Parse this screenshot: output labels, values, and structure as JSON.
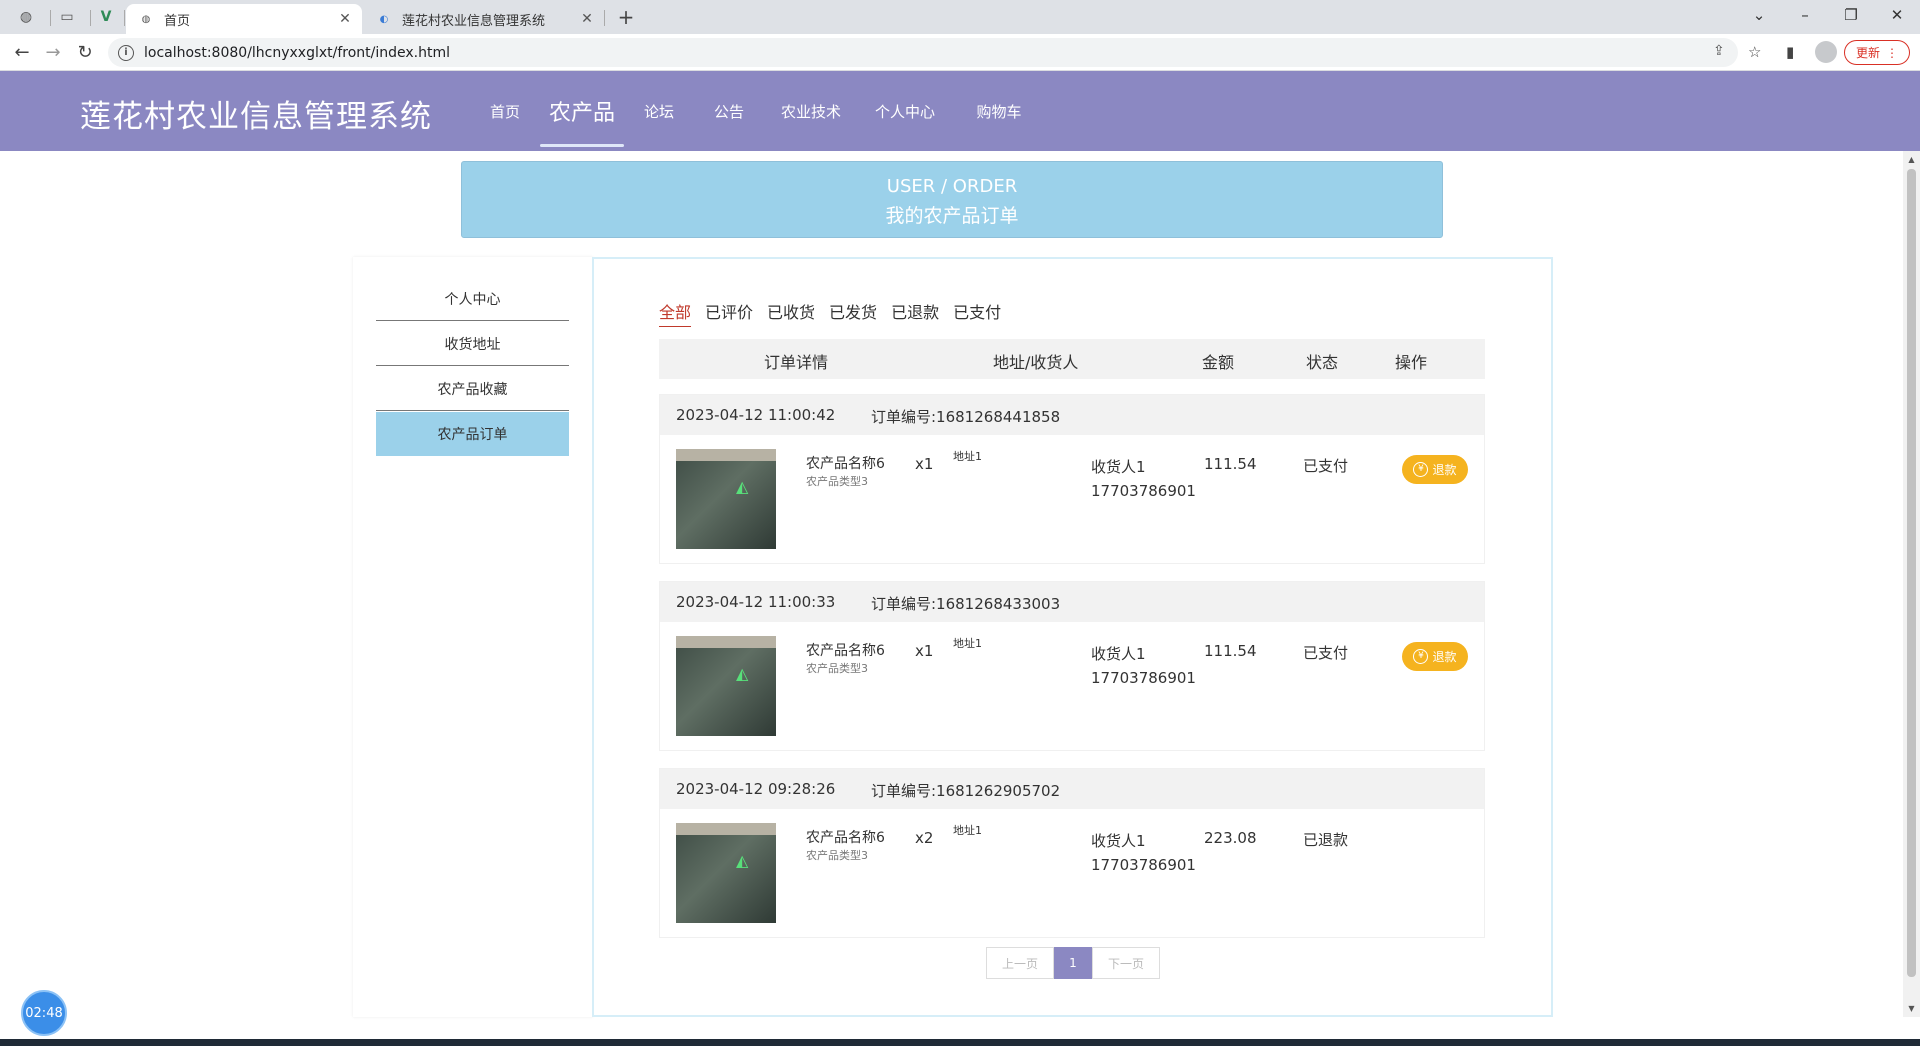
{
  "browser": {
    "tabs": [
      {
        "label": "首页",
        "active": true
      },
      {
        "label": "莲花村农业信息管理系统",
        "active": false
      }
    ],
    "url": "localhost:8080/lhcnyxxglxt/front/index.html",
    "update_label": "更新"
  },
  "header": {
    "title": "莲花村农业信息管理系统",
    "nav": [
      "首页",
      "农产品",
      "论坛",
      "公告",
      "农业技术",
      "个人中心",
      "购物车"
    ],
    "active_nav": "农产品"
  },
  "banner": {
    "line1": "USER / ORDER",
    "line2": "我的农产品订单"
  },
  "sidebar": {
    "items": [
      "个人中心",
      "收货地址",
      "农产品收藏",
      "农产品订单"
    ],
    "active": "农产品订单"
  },
  "filters": {
    "items": [
      "全部",
      "已评价",
      "已收货",
      "已发货",
      "已退款",
      "已支付"
    ],
    "active": "全部"
  },
  "table_header": [
    "订单详情",
    "地址/收货人",
    "金额",
    "状态",
    "操作"
  ],
  "orders": [
    {
      "date": "2023-04-12 11:00:42",
      "order_no": "订单编号:1681268441858",
      "product_name": "农产品名称6",
      "product_type": "农产品类型3",
      "quantity": "x1",
      "address": "地址1",
      "receiver": "收货人1",
      "phone": "17703786901",
      "amount": "111.54",
      "status": "已支付",
      "action": "退款"
    },
    {
      "date": "2023-04-12 11:00:33",
      "order_no": "订单编号:1681268433003",
      "product_name": "农产品名称6",
      "product_type": "农产品类型3",
      "quantity": "x1",
      "address": "地址1",
      "receiver": "收货人1",
      "phone": "17703786901",
      "amount": "111.54",
      "status": "已支付",
      "action": "退款"
    },
    {
      "date": "2023-04-12 09:28:26",
      "order_no": "订单编号:1681262905702",
      "product_name": "农产品名称6",
      "product_type": "农产品类型3",
      "quantity": "x2",
      "address": "地址1",
      "receiver": "收货人1",
      "phone": "17703786901",
      "amount": "223.08",
      "status": "已退款",
      "action": ""
    }
  ],
  "pagination": {
    "prev": "上一页",
    "current": "1",
    "next": "下一页"
  },
  "clock": "02:48",
  "colors": {
    "header_bg": "#8b88c2",
    "banner_bg": "#9bd1ea",
    "refund_button": "#f5b31f",
    "active_filter": "#c0392b"
  }
}
